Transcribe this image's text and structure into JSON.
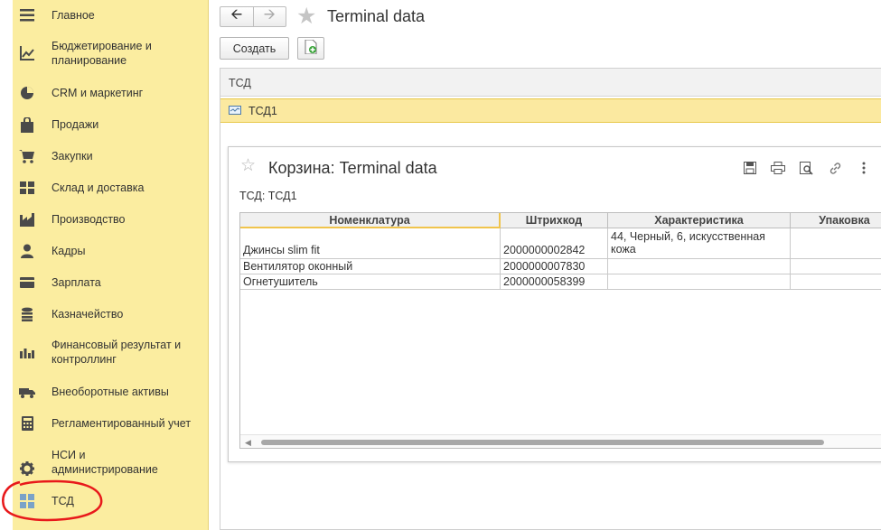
{
  "sidebar": {
    "items": [
      {
        "label": "Главное",
        "icon": "menu-icon"
      },
      {
        "label": "Бюджетирование и\nпланирование",
        "icon": "chart-trend-icon"
      },
      {
        "label": "CRM и маркетинг",
        "icon": "pie-chart-icon"
      },
      {
        "label": "Продажи",
        "icon": "shopping-bag-icon"
      },
      {
        "label": "Закупки",
        "icon": "cart-icon"
      },
      {
        "label": "Склад и доставка",
        "icon": "warehouse-grid-icon"
      },
      {
        "label": "Производство",
        "icon": "factory-icon"
      },
      {
        "label": "Кадры",
        "icon": "person-icon"
      },
      {
        "label": "Зарплата",
        "icon": "wallet-icon"
      },
      {
        "label": "Казначейство",
        "icon": "coins-icon"
      },
      {
        "label": "Финансовый результат и\nконтроллинг",
        "icon": "bar-chart-icon"
      },
      {
        "label": "Внеоборотные активы",
        "icon": "truck-icon"
      },
      {
        "label": "Регламентированный учет",
        "icon": "calculator-icon"
      },
      {
        "label": "НСИ и\nадминистрирование",
        "icon": "gear-icon"
      },
      {
        "label": "ТСД",
        "icon": "tiles-icon"
      }
    ]
  },
  "header": {
    "title": "Terminal data",
    "back_icon": "arrow-left-icon",
    "forward_icon": "arrow-right-icon",
    "favorite_icon": "star-icon"
  },
  "toolbar": {
    "create_label": "Создать",
    "add_icon": "document-add-icon"
  },
  "list": {
    "column_header": "ТСД",
    "rows": [
      {
        "label": "ТСД1",
        "icon": "terminal-icon"
      }
    ]
  },
  "basket": {
    "title": "Корзина: Terminal data",
    "tsd_line": "ТСД: ТСД1",
    "tool_icons": [
      "save-icon",
      "print-icon",
      "preview-icon",
      "link-icon",
      "more-icon"
    ],
    "columns": [
      "Номенклатура",
      "Штрихкод",
      "Характеристика",
      "Упаковка"
    ],
    "rows": [
      {
        "name": "Джинсы slim fit",
        "barcode": "2000000002842",
        "characteristic": "44, Черный, 6, искусственная кожа",
        "package": ""
      },
      {
        "name": "Вентилятор оконный",
        "barcode": "2000000007830",
        "characteristic": "",
        "package": ""
      },
      {
        "name": "Огнетушитель",
        "barcode": "2000000058399",
        "characteristic": "",
        "package": ""
      }
    ]
  },
  "colors": {
    "sidebar_bg": "#fbeda0",
    "selected_row": "#fbe9a0",
    "annotation_circle": "#e8191b"
  }
}
